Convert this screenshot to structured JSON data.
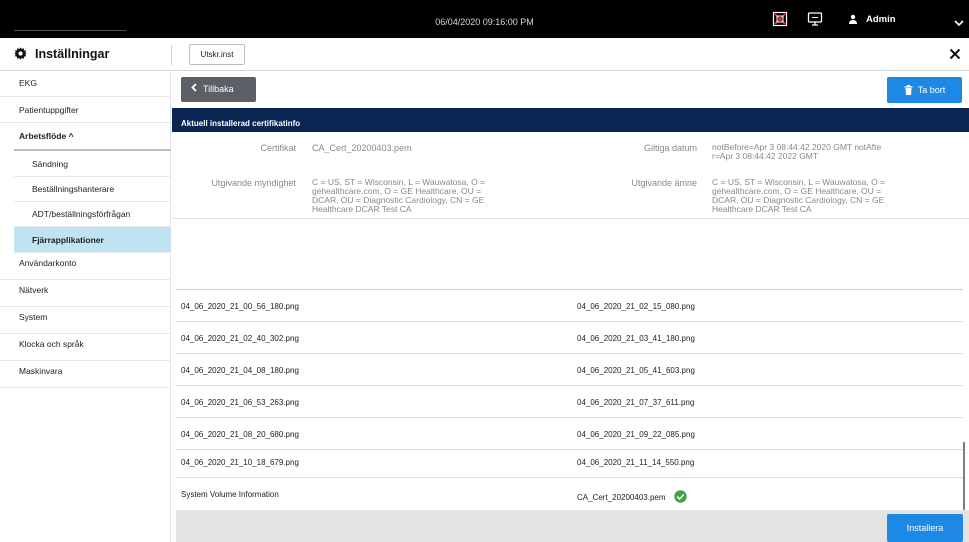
{
  "topbar": {
    "datetime": "06/04/2020 09:16:00 PM",
    "user": "Admin",
    "icons": [
      "network-status-icon",
      "monitor-icon",
      "user-icon",
      "chevron-down-icon"
    ]
  },
  "header": {
    "title": "Inställningar",
    "print_button": "Utskr.inst"
  },
  "sidebar": {
    "items": [
      {
        "label": "EKG"
      },
      {
        "label": "Patientuppgifter"
      },
      {
        "label": "Arbetsflöde  ^"
      },
      {
        "label": "Användarkonto"
      },
      {
        "label": "Nätverk"
      },
      {
        "label": "System"
      },
      {
        "label": "Klocka och språk"
      },
      {
        "label": "Maskinvara"
      }
    ],
    "subitems": [
      {
        "label": "Sändning"
      },
      {
        "label": "Beställningshanterare"
      },
      {
        "label": "ADT/beställningsförfrågan"
      },
      {
        "label": "Fjärrapplikationer"
      }
    ]
  },
  "main": {
    "back_button": "Tillbaka",
    "delete_button": "Ta bort",
    "cert_header": "Aktuell installerad certifikatinfo",
    "cert": {
      "certificate_label": "Certifikat",
      "certificate_value": "CA_Cert_20200403.pem",
      "validity_label": "Giltiga datum",
      "validity_line1": "notBefore=Apr 3 08:44:42 2020 GMT notAfte",
      "validity_line2": "r=Apr 3 08:44:42 2022 GMT",
      "issuer_label": "Utgivande myndighet",
      "issuer_lines": [
        "C = US, ST = Wisconsin, L = Wauwatosa, O =",
        "gehealthcare.com, O = GE Healthcare, OU =",
        "DCAR, OU = Diagnostic Cardiology, CN = GE",
        "Healthcare DCAR Test CA"
      ],
      "subject_label": "Utgivande ämne",
      "subject_lines": [
        "C = US, ST = Wisconsin, L = Wauwatosa, O =",
        "gehealthcare.com, O = GE Healthcare, OU =",
        "DCAR, OU = Diagnostic Cardiology, CN = GE",
        "Healthcare DCAR Test CA"
      ]
    },
    "files": [
      [
        "04_06_2020_21_00_56_180.png",
        "04_06_2020_21_02_15_080.png"
      ],
      [
        "04_06_2020_21_02_40_302.png",
        "04_06_2020_21_03_41_180.png"
      ],
      [
        "04_06_2020_21_04_08_180.png",
        "04_06_2020_21_05_41_603.png"
      ],
      [
        "04_06_2020_21_06_53_263.png",
        "04_06_2020_21_07_37_611.png"
      ],
      [
        "04_06_2020_21_08_20_680.png",
        "04_06_2020_21_09_22_085.png"
      ],
      [
        "04_06_2020_21_10_18_679.png",
        "04_06_2020_21_11_14_550.png"
      ],
      [
        "System Volume Information",
        "CA_Cert_20200403.pem"
      ]
    ],
    "install_button": "Installera"
  },
  "colors": {
    "accent": "#1e88e5",
    "header_bar": "#0b2653",
    "active_nav": "#bfe3f1",
    "check": "#43a047"
  }
}
